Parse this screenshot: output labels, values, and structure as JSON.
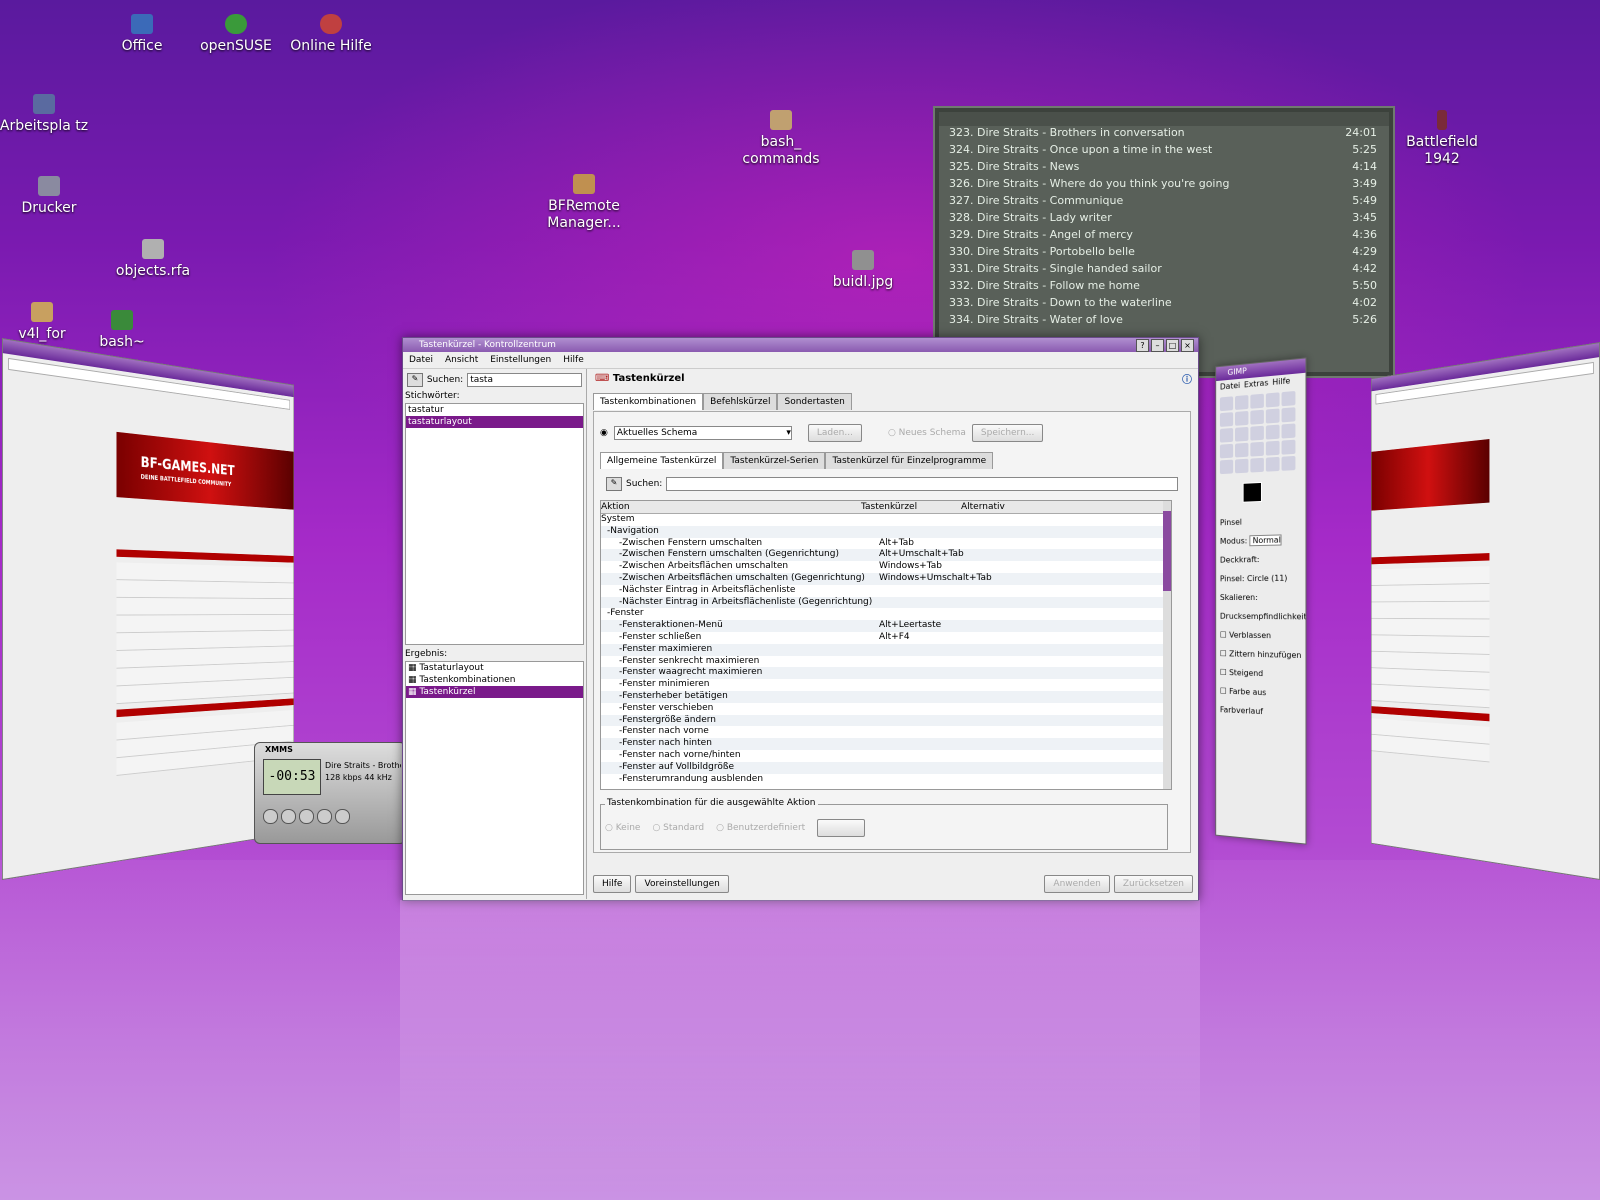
{
  "desktop": {
    "icons": [
      {
        "id": "office",
        "label": "Office"
      },
      {
        "id": "opensuse",
        "label": "openSUSE"
      },
      {
        "id": "online-hilfe",
        "label": "Online Hilfe"
      },
      {
        "id": "arbeitsplatz",
        "label": "Arbeitspla tz"
      },
      {
        "id": "drucker",
        "label": "Drucker"
      },
      {
        "id": "objects",
        "label": "objects.rfa"
      },
      {
        "id": "v4l",
        "label": "v4l_for"
      },
      {
        "id": "bash",
        "label": "bash~"
      },
      {
        "id": "bash-commands",
        "label": "bash_ commands"
      },
      {
        "id": "bfremote",
        "label": "BFRemote Manager..."
      },
      {
        "id": "buidl",
        "label": "buidl.jpg"
      },
      {
        "id": "battlefield",
        "label": "Battlefield 1942"
      }
    ]
  },
  "music": {
    "tracks": [
      {
        "title": "323. Dire Straits - Brothers in conversation",
        "time": "24:01"
      },
      {
        "title": "324. Dire Straits - Once upon a time in the west",
        "time": "5:25"
      },
      {
        "title": "325. Dire Straits - News",
        "time": "4:14"
      },
      {
        "title": "326. Dire Straits - Where do you think you're going",
        "time": "3:49"
      },
      {
        "title": "327. Dire Straits - Communique",
        "time": "5:49"
      },
      {
        "title": "328. Dire Straits - Lady writer",
        "time": "3:45"
      },
      {
        "title": "329. Dire Straits - Angel of mercy",
        "time": "4:36"
      },
      {
        "title": "330. Dire Straits - Portobello belle",
        "time": "4:29"
      },
      {
        "title": "331. Dire Straits - Single handed sailor",
        "time": "4:42"
      },
      {
        "title": "332. Dire Straits - Follow me home",
        "time": "5:50"
      },
      {
        "title": "333. Dire Straits - Down to the waterline",
        "time": "4:02"
      },
      {
        "title": "334. Dire Straits - Water of love",
        "time": "5:26"
      }
    ]
  },
  "main": {
    "title": "Tastenkürzel - Kontrollzentrum",
    "menu": [
      "Datei",
      "Ansicht",
      "Einstellungen",
      "Hilfe"
    ],
    "search_label": "Suchen:",
    "search_value": "tasta",
    "keywords_label": "Stichwörter:",
    "keywords": [
      "tastatur",
      "tastaturlayout"
    ],
    "results_label": "Ergebnis:",
    "results": [
      "Tastaturlayout",
      "Tastenkombinationen",
      "Tastenkürzel"
    ],
    "page_title": "Tastenkürzel",
    "tabs": [
      "Tastenkombinationen",
      "Befehlskürzel",
      "Sondertasten"
    ],
    "scheme_value": "Aktuelles Schema",
    "scheme_btn": "Laden...",
    "new_scheme": "Neues Schema",
    "save_btn": "Speichern...",
    "subtabs": [
      "Allgemeine Tastenkürzel",
      "Tastenkürzel-Serien",
      "Tastenkürzel für Einzelprogramme"
    ],
    "filter_label": "Suchen:",
    "columns": [
      "Aktion",
      "Tastenkürzel",
      "Alternativ"
    ],
    "rows": [
      {
        "a": "System",
        "k": ""
      },
      {
        "a": "-Navigation",
        "k": ""
      },
      {
        "a": "-Zwischen Fenstern umschalten",
        "k": "Alt+Tab"
      },
      {
        "a": "-Zwischen Fenstern umschalten (Gegenrichtung)",
        "k": "Alt+Umschalt+Tab"
      },
      {
        "a": "-Zwischen Arbeitsflächen umschalten",
        "k": "Windows+Tab"
      },
      {
        "a": "-Zwischen Arbeitsflächen umschalten (Gegenrichtung)",
        "k": "Windows+Umschalt+Tab"
      },
      {
        "a": "-Nächster Eintrag in Arbeitsflächenliste",
        "k": ""
      },
      {
        "a": "-Nächster Eintrag in Arbeitsflächenliste (Gegenrichtung)",
        "k": ""
      },
      {
        "a": "-Fenster",
        "k": ""
      },
      {
        "a": "-Fensteraktionen-Menü",
        "k": "Alt+Leertaste"
      },
      {
        "a": "-Fenster schließen",
        "k": "Alt+F4"
      },
      {
        "a": "-Fenster maximieren",
        "k": ""
      },
      {
        "a": "-Fenster senkrecht maximieren",
        "k": ""
      },
      {
        "a": "-Fenster waagrecht maximieren",
        "k": ""
      },
      {
        "a": "-Fenster minimieren",
        "k": ""
      },
      {
        "a": "-Fensterheber betätigen",
        "k": ""
      },
      {
        "a": "-Fenster verschieben",
        "k": ""
      },
      {
        "a": "-Fenstergröße ändern",
        "k": ""
      },
      {
        "a": "-Fenster nach vorne",
        "k": ""
      },
      {
        "a": "-Fenster nach hinten",
        "k": ""
      },
      {
        "a": "-Fenster nach vorne/hinten",
        "k": ""
      },
      {
        "a": "-Fenster auf Vollbildgröße",
        "k": ""
      },
      {
        "a": "-Fensterumrandung ausblenden",
        "k": ""
      }
    ],
    "group_label": "Tastenkombination für die ausgewählte Aktion",
    "radio_keine": "Keine",
    "radio_standard": "Standard",
    "radio_custom": "Benutzerdefiniert",
    "help_btn": "Hilfe",
    "defaults_btn": "Voreinstellungen",
    "apply_btn": "Anwenden",
    "reset_btn": "Zurücksetzen"
  },
  "gimp": {
    "title": "GIMP",
    "menu": [
      "Datei",
      "Extras",
      "Hilfe"
    ],
    "brushes_label": "Pinsel",
    "mode_label": "Modus:",
    "mode_value": "Normal",
    "opacity_label": "Deckkraft:",
    "brush_label": "Pinsel:",
    "brush_value": "Circle (11)",
    "scale_label": "Skalieren:",
    "pressure": "Drucksempfindlichkeit",
    "fade": "Verblassen",
    "jitter": "Zittern hinzufügen",
    "incremental": "Steigend",
    "gradient": "Farbe aus Farbverlauf"
  },
  "xmms": {
    "title": "XMMS",
    "time": "-00:53",
    "info": "Dire Straits - Brothers",
    "kbps": "128 kbps 44 kHz"
  },
  "browser": {
    "logo": "BF-GAMES.NET",
    "tagline": "DEINE BATTLEFIELD COMMUNITY"
  }
}
